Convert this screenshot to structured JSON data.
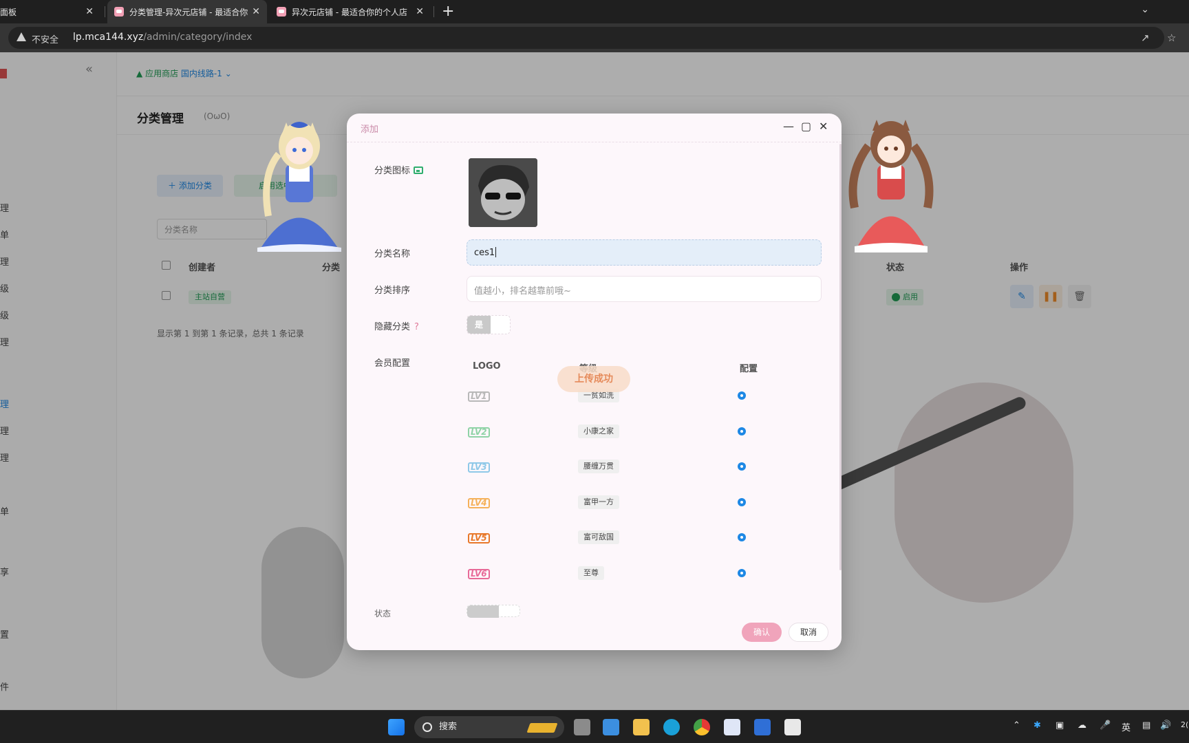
{
  "browser": {
    "tabs": [
      {
        "title": "面板",
        "close": "✕"
      },
      {
        "title": "分类管理-异次元店铺 - 最适合你",
        "close": "✕"
      },
      {
        "title": "异次元店铺 - 最适合你的个人店",
        "close": "✕"
      }
    ],
    "new_tab": "+",
    "insecure_label": "不安全",
    "url_host": "lp.mca144.xyz",
    "url_path": "/admin/category/index"
  },
  "sidebar": {
    "items": [
      "理",
      "单",
      "理",
      "级",
      "级",
      "理",
      "理",
      "理",
      "理",
      "单",
      "享",
      "置",
      "件"
    ],
    "active_index": 6
  },
  "topbar": {
    "store_label": "应用商店",
    "line_label": "国内线路-1"
  },
  "page": {
    "title": "分类管理",
    "subtitle": "(ОωО)",
    "add_button": "添加分类",
    "enable_button": "启用选中分",
    "search_placeholder": "分类名称",
    "columns": [
      "创建者",
      "分类",
      "状态",
      "操作"
    ],
    "row": {
      "creator": "主站自营",
      "status": "启用"
    },
    "footer": "显示第 1 到第 1 条记录，总共 1 条记录"
  },
  "modal": {
    "title": "添加",
    "icon_label": "分类图标",
    "name_label": "分类名称",
    "name_value": "ces1",
    "sort_label": "分类排序",
    "sort_placeholder": "值越小，排名越靠前哦~",
    "hidden_label": "隐藏分类",
    "hidden_help": "?",
    "hidden_on": "是",
    "member_label": "会员配置",
    "table_headers": [
      "LOGO",
      "等级",
      "配置"
    ],
    "levels": [
      {
        "badge": "LV1",
        "name": "一贫如洗",
        "color": "#b8b8b8"
      },
      {
        "badge": "LV2",
        "name": "小康之家",
        "color": "#8fd3a6"
      },
      {
        "badge": "LV3",
        "name": "腰缠万贯",
        "color": "#8ec8e8"
      },
      {
        "badge": "LV4",
        "name": "富甲一方",
        "color": "#f5b15a"
      },
      {
        "badge": "LV5",
        "name": "富可敌国",
        "color": "#e8782a"
      },
      {
        "badge": "LV6",
        "name": "至尊",
        "color": "#e86a98"
      }
    ],
    "toast": "上传成功",
    "cut_label": "状态",
    "confirm": "确认",
    "cancel": "取消"
  },
  "taskbar": {
    "search": "搜索",
    "ime": "英",
    "clock_partial": "2("
  },
  "colors": {
    "accent_blue": "#1e88e5",
    "accent_green": "#1f9d55",
    "confirm_pink": "#f0a4bb",
    "modal_bg": "#fdf7fb"
  }
}
